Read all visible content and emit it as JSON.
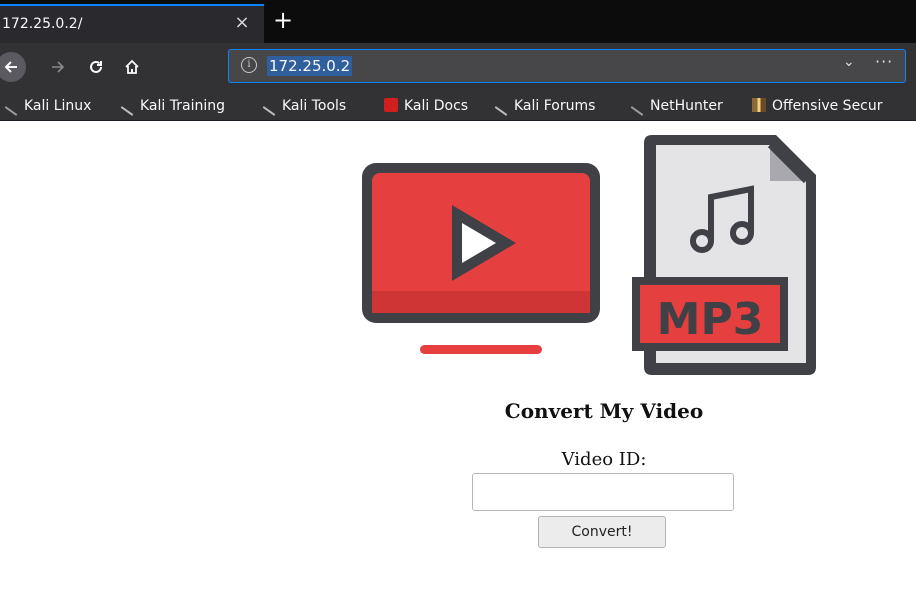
{
  "browser": {
    "tab_title": "172.25.0.2/",
    "tab_close": "×",
    "new_tab": "+",
    "url": "172.25.0.2",
    "info_glyph": "i",
    "dropdown_glyph": "⌄",
    "more_glyph": "···",
    "bookmarks": [
      {
        "label": "Kali Linux",
        "icon": "kali-dragon-icon"
      },
      {
        "label": "Kali Training",
        "icon": "kali-dragon-icon"
      },
      {
        "label": "Kali Tools",
        "icon": "kali-dragon-icon"
      },
      {
        "label": "Kali Docs",
        "icon": "kali-docs-icon"
      },
      {
        "label": "Kali Forums",
        "icon": "kali-dragon-icon"
      },
      {
        "label": "NetHunter",
        "icon": "nethunter-icon"
      },
      {
        "label": "Offensive Secur",
        "icon": "offsec-icon"
      }
    ]
  },
  "page": {
    "heading": "Convert My Video",
    "video_id_label": "Video ID:",
    "video_id_value": "",
    "convert_button": "Convert!",
    "logo": {
      "video_icon": "youtube-play-icon",
      "file_icon": "mp3-file-icon",
      "file_badge_text": "MP3",
      "colors": {
        "red": "#e53f3f",
        "dark": "#3f4146",
        "paper": "#e4e4e6",
        "white": "#ffffff"
      }
    }
  }
}
